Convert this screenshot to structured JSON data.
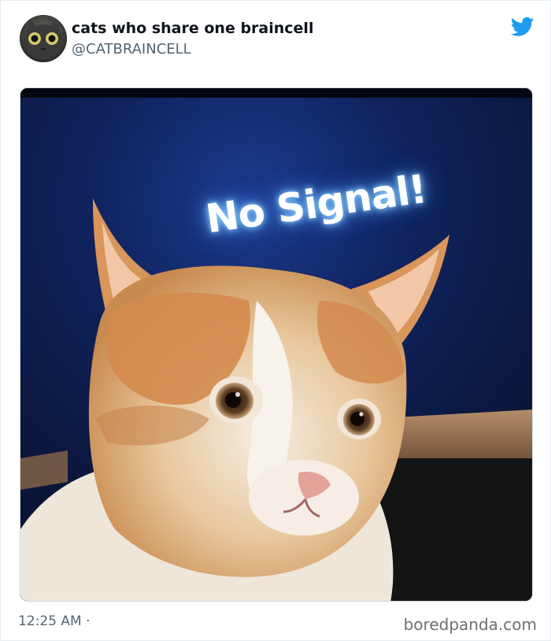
{
  "tweet": {
    "display_name": "cats who share one braincell",
    "handle": "@CATBRAINCELL",
    "image_text": "No Signal!",
    "timestamp": "12:25 AM ·"
  },
  "footer": {
    "source": "boredpanda.com"
  },
  "icons": {
    "platform": "twitter-bird-icon",
    "avatar": "cat-face-avatar"
  },
  "colors": {
    "twitter_blue": "#1d9bf0",
    "handle_gray": "#536471",
    "screen_blue": "#0c1a4a"
  }
}
